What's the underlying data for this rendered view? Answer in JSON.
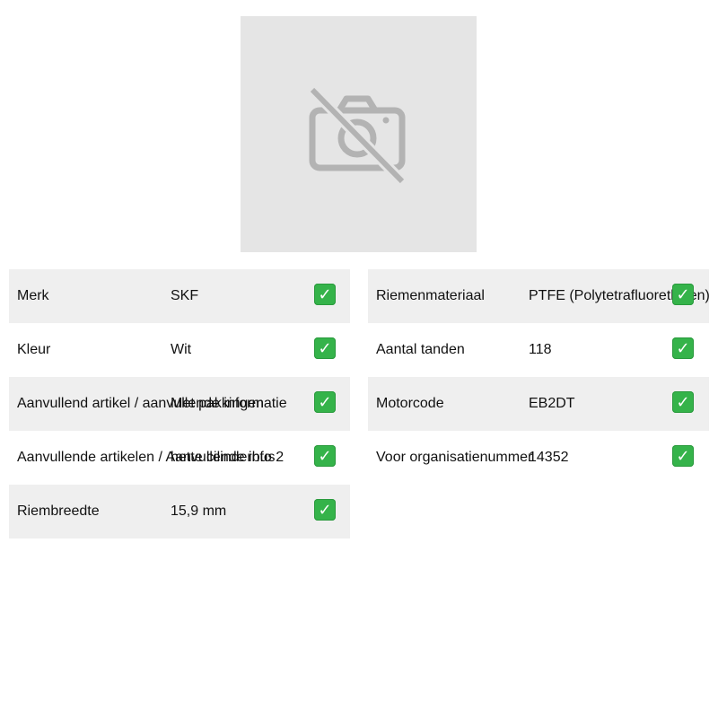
{
  "product_image": {
    "icon": "no-image-camera-icon",
    "background_color": "#e5e5e5"
  },
  "specs_left": [
    {
      "label": "Merk",
      "value": "SKF",
      "check": "✓"
    },
    {
      "label": "Kleur",
      "value": "Wit",
      "check": "✓"
    },
    {
      "label": "Aanvullend artikel / aanvullende informatie",
      "value": "Met pakkingen",
      "check": "✓"
    },
    {
      "label": "Aanvullende artikelen / Aanvullende info 2",
      "value": "hette cilinderbus",
      "check": "✓"
    },
    {
      "label": "Riembreedte",
      "value": "15,9 mm",
      "check": "✓"
    }
  ],
  "specs_right": [
    {
      "label": "Riemenmateriaal",
      "value": "PTFE (Polytetrafluorethylen)",
      "check": "✓"
    },
    {
      "label": "Aantal tanden",
      "value": "118",
      "check": "✓"
    },
    {
      "label": "Motorcode",
      "value": "EB2DT",
      "check": "✓"
    },
    {
      "label": "Voor organisatienummer",
      "value": "14352",
      "check": "✓"
    }
  ],
  "colors": {
    "row_shade": "#efefef",
    "check_green": "#35b34a"
  }
}
